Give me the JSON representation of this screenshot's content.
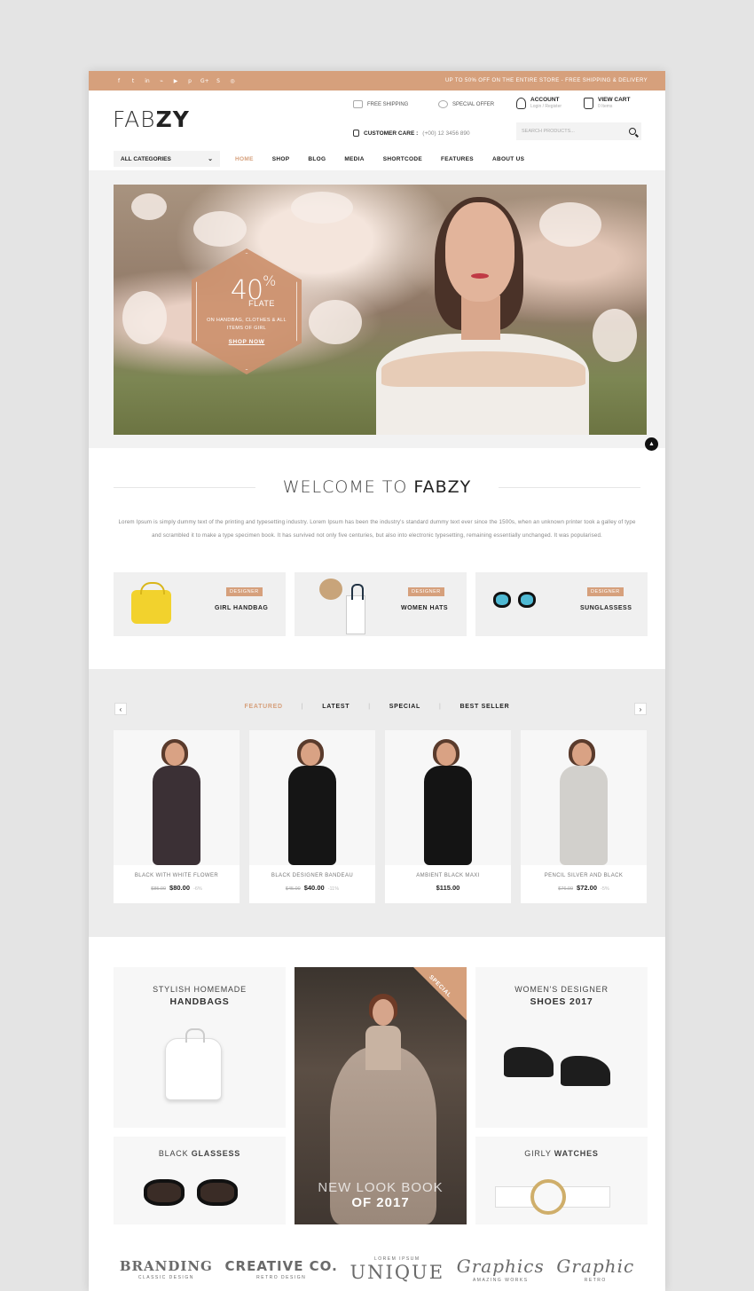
{
  "topbar": {
    "social_icons": [
      "facebook-icon",
      "twitter-icon",
      "linkedin-icon",
      "rss-icon",
      "youtube-icon",
      "pinterest-icon",
      "google-plus-icon",
      "skype-icon",
      "instagram-icon"
    ],
    "social_glyphs": [
      "f",
      "t",
      "in",
      "⌁",
      "▶",
      "p",
      "G+",
      "S",
      "◎"
    ],
    "promo": "UP TO 50% OFF ON THE ENTIRE STORE - FREE SHIPPING & DELIVERY"
  },
  "header": {
    "logo_light": "FAB",
    "logo_bold": "ZY",
    "free_shipping": "FREE SHIPPING",
    "special_offer": "SPECIAL OFFER",
    "account_label": "ACCOUNT",
    "account_sub": "Login / Register",
    "cart_label": "VIEW CART",
    "cart_sub": "0 Items",
    "customer_care_label": "CUSTOMER CARE :",
    "customer_care_number": "(+00) 12 3456 890",
    "search_placeholder": "SEARCH PRODUCTS..."
  },
  "nav": {
    "category_select": "ALL CATEGORIES",
    "items": [
      "HOME",
      "SHOP",
      "BLOG",
      "MEDIA",
      "SHORTCODE",
      "FEATURES",
      "ABOUT US"
    ],
    "active": "HOME"
  },
  "hero": {
    "percent": "40",
    "percent_sign": "%",
    "flate": "FLATE",
    "subtitle": "ON HANDBAG, CLOTHES & ALL ITEMS OF GIRL",
    "cta": "SHOP NOW"
  },
  "welcome": {
    "title_light": "WELCOME TO",
    "title_bold": "FABZY",
    "text": "Lorem Ipsum is simply dummy text of the printing and typesetting industry. Lorem Ipsum has been the industry's standard dummy text ever since the 1500s, when an unknown printer took a galley of type and scrambled it to make a type specimen book. It has survived not only five centuries, but also into electronic typesetting, remaining essentially unchanged. It was popularised.",
    "categories": [
      {
        "badge": "DESIGNER",
        "name": "GIRL HANDBAG"
      },
      {
        "badge": "DESIGNER",
        "name": "WOMEN HATS"
      },
      {
        "badge": "DESIGNER",
        "name": "SUNGLASSESS"
      }
    ]
  },
  "products": {
    "tabs": [
      "FEATURED",
      "LATEST",
      "SPECIAL",
      "BEST SELLER"
    ],
    "active_tab": "FEATURED",
    "prev": "‹",
    "next": "›",
    "items": [
      {
        "name": "BLACK WITH WHITE FLOWER",
        "old_price": "$85.00",
        "price": "$80.00",
        "discount": "-6%",
        "color": "#3b3035"
      },
      {
        "name": "BLACK DESIGNER BANDEAU",
        "old_price": "$45.00",
        "price": "$40.00",
        "discount": "-11%",
        "color": "#151515"
      },
      {
        "name": "AMBIENT BLACK MAXI",
        "old_price": "",
        "price": "$115.00",
        "discount": "",
        "color": "#141414"
      },
      {
        "name": "PENCIL SILVER AND BLACK",
        "old_price": "$76.00",
        "price": "$72.00",
        "discount": "-5%",
        "color": "#d2d0cc"
      }
    ]
  },
  "banners": {
    "handbags_t1": "STYLISH HOMEMADE",
    "handbags_t2": "HANDBAGS",
    "shoes_t1": "WOMEN'S DESIGNER",
    "shoes_t2": "SHOES 2017",
    "glasses_t1": "BLACK",
    "glasses_t2": "GLASSESS",
    "watches_t1": "GIRLY",
    "watches_t2": "WATCHES",
    "ribbon": "SPECIAL OFFER",
    "lookbook_1": "NEW LOOK BOOK",
    "lookbook_2": "OF 2017"
  },
  "brands": [
    {
      "b1": "BRANDING",
      "b2": "CLASSIC DESIGN"
    },
    {
      "b1": "CREATIVE CO.",
      "b2": "RETRO DESIGN"
    },
    {
      "b1": "UNIQUE",
      "b2": "LOREM IPSUM"
    },
    {
      "b1": "Graphics",
      "b2": "AMAZING WORKS"
    },
    {
      "b1": "Graphic",
      "b2": "RETRO"
    }
  ],
  "colors": {
    "accent": "#d6a07c",
    "dark": "#222222",
    "light_bg": "#f0f0f0"
  }
}
